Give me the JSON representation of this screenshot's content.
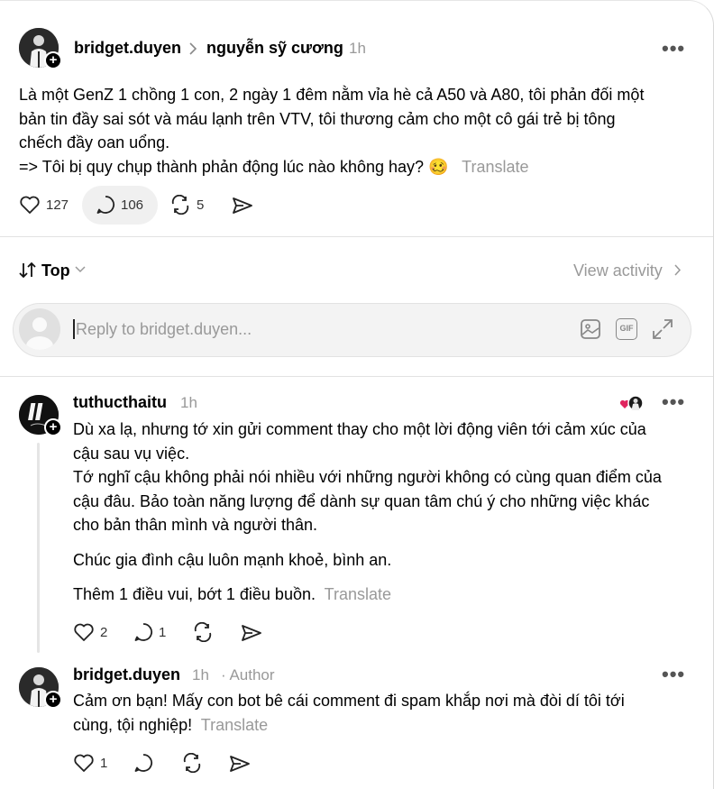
{
  "post": {
    "author": "bridget.duyen",
    "reply_to": "nguyễn sỹ cương",
    "time": "1h",
    "text_lines": [
      "Là một GenZ 1 chồng 1 con, 2 ngày 1 đêm nằm vỉa hè cả A50 và A80, tôi phản đối một",
      "bản tin đầy sai sót và máu lạnh trên VTV, tôi thương cảm cho một cô gái trẻ bị tông",
      "chếch đầy oan uổng.",
      "=> Tôi bị quy chụp thành phản động lúc nào không hay? 🥴"
    ],
    "translate": "Translate",
    "likes": "127",
    "replies": "106",
    "reposts": "5"
  },
  "sort": {
    "label": "Top",
    "view_activity": "View activity"
  },
  "reply_input": {
    "placeholder": "Reply to bridget.duyen..."
  },
  "comments": [
    {
      "author": "tuthucthaitu",
      "time": "1h",
      "paragraphs": [
        "Dù xa lạ, nhưng tớ xin gửi comment thay cho một lời động viên tới cảm xúc của",
        "cậu sau vụ việc.",
        "Tớ nghĩ cậu không phải nói nhiều với những người không có cùng quan điểm của",
        "cậu đâu. Bảo toàn năng lượng để dành sự quan tâm chú ý cho những việc khác",
        "cho bản thân mình và người thân.",
        "Chúc gia đình cậu luôn mạnh khoẻ, bình an.",
        "Thêm 1 điều vui, bớt 1 điều buồn."
      ],
      "translate": "Translate",
      "likes": "2",
      "replies": "1"
    },
    {
      "author": "bridget.duyen",
      "time": "1h",
      "tag": "· Author",
      "lines": [
        "Cảm ơn bạn! Mấy con bot bê cái comment đi spam khắp nơi mà đòi dí tôi tới",
        "cùng, tội nghiệp!"
      ],
      "translate": "Translate",
      "likes": "1"
    }
  ],
  "icons": {
    "more": "more-icon",
    "heart": "heart-icon",
    "comment": "comment-icon",
    "repost": "repost-icon",
    "share": "share-icon",
    "chevron": "chevron-right-icon",
    "sort": "sort-icon",
    "image": "image-icon",
    "gif": "gif-icon",
    "expand": "expand-icon"
  },
  "more_glyph": "•••",
  "gif_label": "GIF"
}
